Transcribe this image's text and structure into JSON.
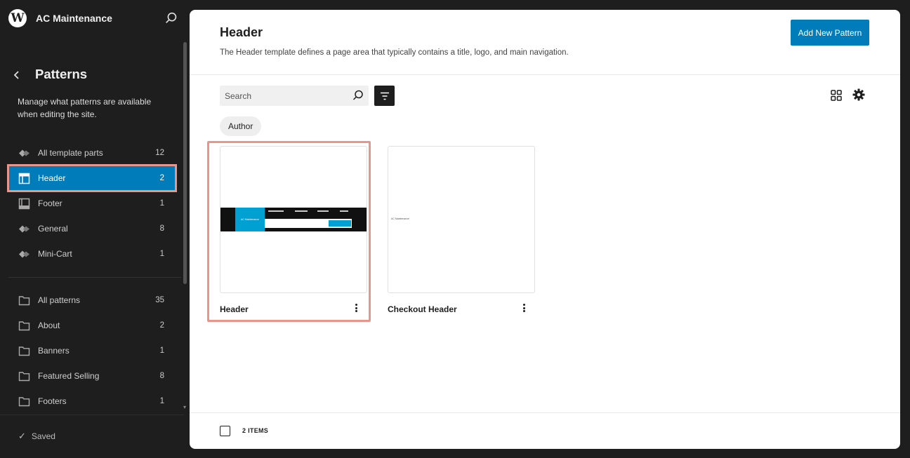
{
  "site": {
    "title": "AC Maintenance"
  },
  "sidebar": {
    "title": "Patterns",
    "description": "Manage what patterns are available when editing the site.",
    "template_parts": [
      {
        "label": "All template parts",
        "count": "12",
        "icon": "diamond-icon"
      },
      {
        "label": "Header",
        "count": "2",
        "icon": "header-icon",
        "active": true
      },
      {
        "label": "Footer",
        "count": "1",
        "icon": "footer-icon"
      },
      {
        "label": "General",
        "count": "8",
        "icon": "diamond-icon"
      },
      {
        "label": "Mini-Cart",
        "count": "1",
        "icon": "diamond-icon"
      }
    ],
    "categories": [
      {
        "label": "All patterns",
        "count": "35",
        "icon": "folder-icon"
      },
      {
        "label": "About",
        "count": "2",
        "icon": "folder-icon"
      },
      {
        "label": "Banners",
        "count": "1",
        "icon": "folder-icon"
      },
      {
        "label": "Featured Selling",
        "count": "8",
        "icon": "folder-icon"
      },
      {
        "label": "Footers",
        "count": "1",
        "icon": "folder-icon"
      }
    ],
    "status": "Saved"
  },
  "main": {
    "title": "Header",
    "description": "The Header template defines a page area that typically contains a title, logo, and main navigation.",
    "add_button": "Add New Pattern",
    "search_placeholder": "Search",
    "filter_chip": "Author",
    "cards": [
      {
        "name": "Header",
        "preview_logo": "AC Maintenance"
      },
      {
        "name": "Checkout Header",
        "preview_text": "AC Maintenance"
      }
    ],
    "items_count": "2 ITEMS"
  },
  "colors": {
    "accent": "#007cba",
    "highlight": "#e8968c",
    "sidebar_bg": "#1e1e1e"
  }
}
